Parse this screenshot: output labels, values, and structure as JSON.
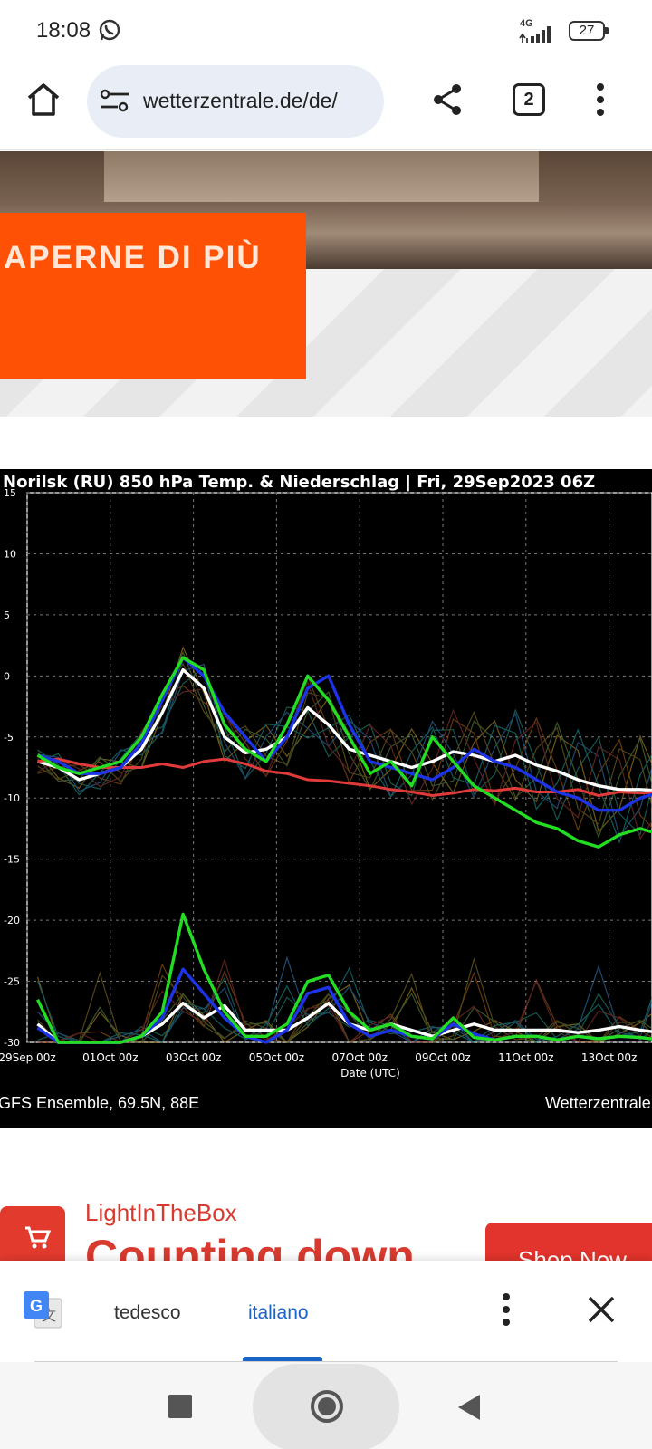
{
  "status_bar": {
    "time": "18:08",
    "network": "4G",
    "battery": "27"
  },
  "browser": {
    "url": "wetterzentrale.de/de/",
    "tab_count": "2"
  },
  "ad_top": {
    "cta": "APERNE DI PIÙ"
  },
  "chart": {
    "title": "Norilsk  (RU)  850 hPa Temp. & Niederschlag | Fri, 29Sep2023 06Z",
    "footer_left": "GFS Ensemble, 69.5N, 88E",
    "footer_right": "Wetterzentrale",
    "xlabel": "Date (UTC)"
  },
  "chart_data": {
    "type": "line",
    "title": "Norilsk  (RU)  850 hPa Temp. & Niederschlag | Fri, 29Sep2023 06Z",
    "xlabel": "Date (UTC)",
    "ylabel": "",
    "ylim": [
      -30,
      15
    ],
    "yticks": [
      "15",
      "10",
      "5",
      "0",
      "-5",
      "-10",
      "-15",
      "-20",
      "-25",
      "-30"
    ],
    "xticks": [
      "29Sep 00z",
      "01Oct 00z",
      "03Oct 00z",
      "05Oct 00z",
      "07Oct 00z",
      "09Oct 00z",
      "11Oct 00z",
      "13Oct 00z"
    ],
    "grid": true,
    "x_days": [
      0.25,
      0.75,
      1.25,
      1.75,
      2.25,
      2.75,
      3.25,
      3.75,
      4.25,
      4.75,
      5.25,
      5.75,
      6.25,
      6.75,
      7.25,
      7.75,
      8.25,
      8.75,
      9.25,
      9.75,
      10.25,
      10.75,
      11.25,
      11.75,
      12.25,
      12.75,
      13.25,
      13.75,
      14.25,
      14.75,
      15.25
    ],
    "series": [
      {
        "color": "#ffffff",
        "values": [
          -7,
          -7.5,
          -8.5,
          -8,
          -7.5,
          -6,
          -3,
          0.5,
          -1,
          -5,
          -6.3,
          -6,
          -5,
          -2.6,
          -4,
          -6,
          -6.5,
          -7,
          -7.5,
          -7,
          -6.2,
          -6.5,
          -7,
          -6.5,
          -7.3,
          -7.8,
          -8.5,
          -9,
          -9.3,
          -9.3,
          -9.4
        ]
      },
      {
        "color": "#e03a3a",
        "values": [
          -7,
          -6.8,
          -7.2,
          -7.5,
          -7.5,
          -7.5,
          -7.2,
          -7.5,
          -7,
          -6.8,
          -7.2,
          -7.8,
          -8,
          -8.5,
          -8.6,
          -8.8,
          -9,
          -9.3,
          -9.5,
          -9.8,
          -9.6,
          -9.3,
          -9.4,
          -9.2,
          -9.5,
          -9.5,
          -9.3,
          -9.8,
          -9.5,
          -9.6,
          -9.5
        ]
      },
      {
        "color": "#1c34e6",
        "values": [
          -6.5,
          -7,
          -8,
          -8,
          -7.5,
          -5.5,
          -2,
          1.5,
          0,
          -3,
          -5,
          -7,
          -5,
          -1,
          0,
          -4,
          -7,
          -7.5,
          -8,
          -8.5,
          -7.5,
          -6,
          -7,
          -7.5,
          -8.5,
          -9.5,
          -10,
          -11,
          -11,
          -10,
          -9.5
        ]
      },
      {
        "color": "#22dd22",
        "values": [
          -6.5,
          -7.5,
          -8,
          -7.5,
          -7,
          -5,
          -1.5,
          1.5,
          0.5,
          -4,
          -6,
          -7,
          -4,
          0,
          -2,
          -5,
          -8,
          -7,
          -9,
          -5,
          -7,
          -9,
          -10,
          -11,
          -12,
          -12.5,
          -13.5,
          -14,
          -13,
          -12.5,
          -13
        ]
      },
      {
        "color": "#ffffff",
        "values": [
          -28.5,
          -30,
          -30,
          -30,
          -30,
          -29.5,
          -28.5,
          -26.8,
          -28,
          -27,
          -29,
          -29,
          -29,
          -28,
          -26.8,
          -28.5,
          -29,
          -28.5,
          -29,
          -29.5,
          -29,
          -28.5,
          -29,
          -29,
          -29,
          -29,
          -29.2,
          -29,
          -28.7,
          -29,
          -29.2
        ]
      },
      {
        "color": "#1c34e6",
        "values": [
          -28.8,
          -30,
          -30,
          -30,
          -30,
          -29.5,
          -28,
          -24,
          -26,
          -28,
          -29.5,
          -30,
          -29,
          -26,
          -25.5,
          -28.5,
          -29.5,
          -29,
          -29.5,
          -29.7,
          -28.5,
          -29.3,
          -29.8,
          -29.5,
          -29.5,
          -29.8,
          -29.5,
          -29.7,
          -29.5,
          -29.6,
          -29.8
        ]
      },
      {
        "color": "#22dd22",
        "values": [
          -26.5,
          -30,
          -30,
          -30,
          -30,
          -29.5,
          -27.5,
          -19.5,
          -24,
          -27.5,
          -29.5,
          -29.5,
          -28.5,
          -25,
          -24.5,
          -27.5,
          -29,
          -28.5,
          -29.5,
          -29.7,
          -28,
          -29.6,
          -29.8,
          -29.5,
          -29.5,
          -29.8,
          -29.5,
          -29.7,
          -29.5,
          -29.6,
          -29.8
        ]
      }
    ]
  },
  "ad_bottom": {
    "brand": "LightInTheBox",
    "headline": "Counting down",
    "button": "Shop Now"
  },
  "translate": {
    "source_language": "tedesco",
    "target_language": "italiano"
  }
}
